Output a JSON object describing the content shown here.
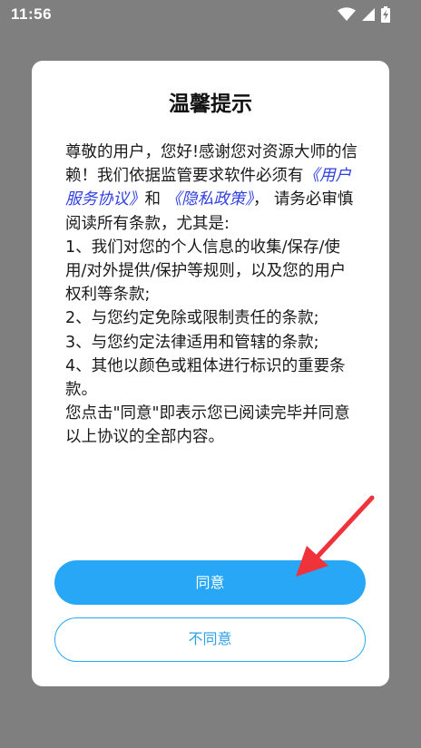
{
  "status_bar": {
    "time": "11:56",
    "icons": [
      "wifi-icon",
      "signal-icon",
      "battery-charging-icon"
    ]
  },
  "dialog": {
    "title": "温馨提示",
    "body": {
      "intro": "尊敬的用户，您好!感谢您对资源大师的信赖！我们依据监管要求软件必须有",
      "link_user_agreement": "《用户服务协议》",
      "and": "和",
      "link_privacy_policy": "《隐私政策》",
      "after_links": "， 请务必审慎阅读所有条款，尤其是:",
      "item1": "1、我们对您的个人信息的收集/保存/使用/对外提供/保护等规则，以及您的用户权利等条款;",
      "item2": "2、与您约定免除或限制责任的条款;",
      "item3": "3、与您约定法律适用和管辖的条款;",
      "item4": "4、其他以颜色或粗体进行标识的重要条款。",
      "closing": "您点击\"同意\"即表示您已阅读完毕并同意以上协议的全部内容。"
    },
    "agree_label": "同意",
    "disagree_label": "不同意"
  },
  "colors": {
    "overlay": "#7f7f7f",
    "accent": "#28a7f6",
    "link": "#2f3fe0",
    "annotation_arrow": "#f0333a"
  }
}
